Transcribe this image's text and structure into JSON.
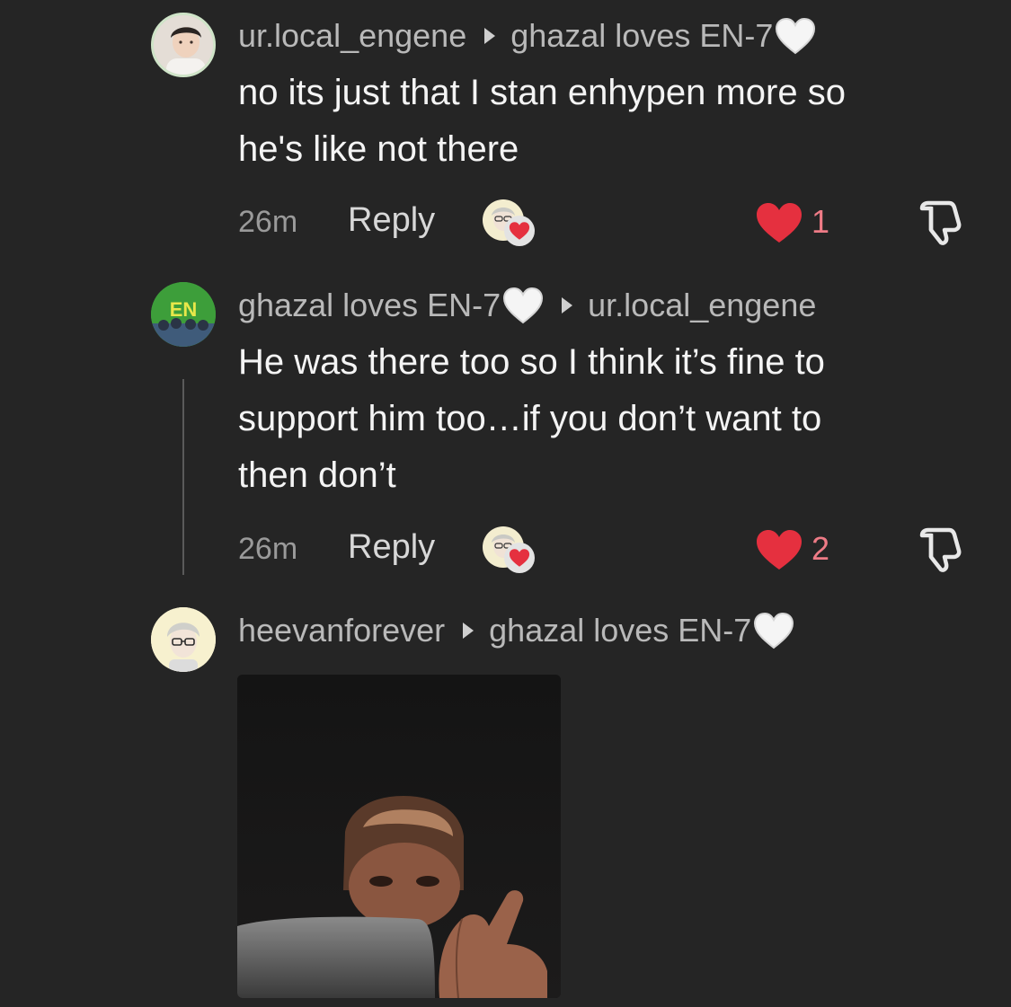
{
  "comments": [
    {
      "author": "ur.local_engene",
      "reply_to": "ghazal loves EN-7",
      "reply_to_emoji": "white-heart-emoji",
      "text_lines": [
        "no its just that I stan enhypen more so",
        "he's like not there"
      ],
      "time": "26m",
      "reply_label": "Reply",
      "likes": "1"
    },
    {
      "author": "ghazal loves EN-7",
      "author_emoji": "white-heart-emoji",
      "reply_to": "ur.local_engene",
      "text_lines": [
        "He was there too so I think it’s fine to",
        "support him too…if you don’t want to",
        "then don’t"
      ],
      "time": "26m",
      "reply_label": "Reply",
      "likes": "2",
      "avatar_logo_text": "EN"
    },
    {
      "author": "heevanforever",
      "reply_to": "ghazal loves EN-7",
      "reply_to_emoji": "white-heart-emoji",
      "attachment": "image"
    }
  ],
  "colors": {
    "background": "#252525",
    "like_heart": "#e5303f",
    "like_count": "#ee7b86",
    "username": "#b9b9b9"
  }
}
